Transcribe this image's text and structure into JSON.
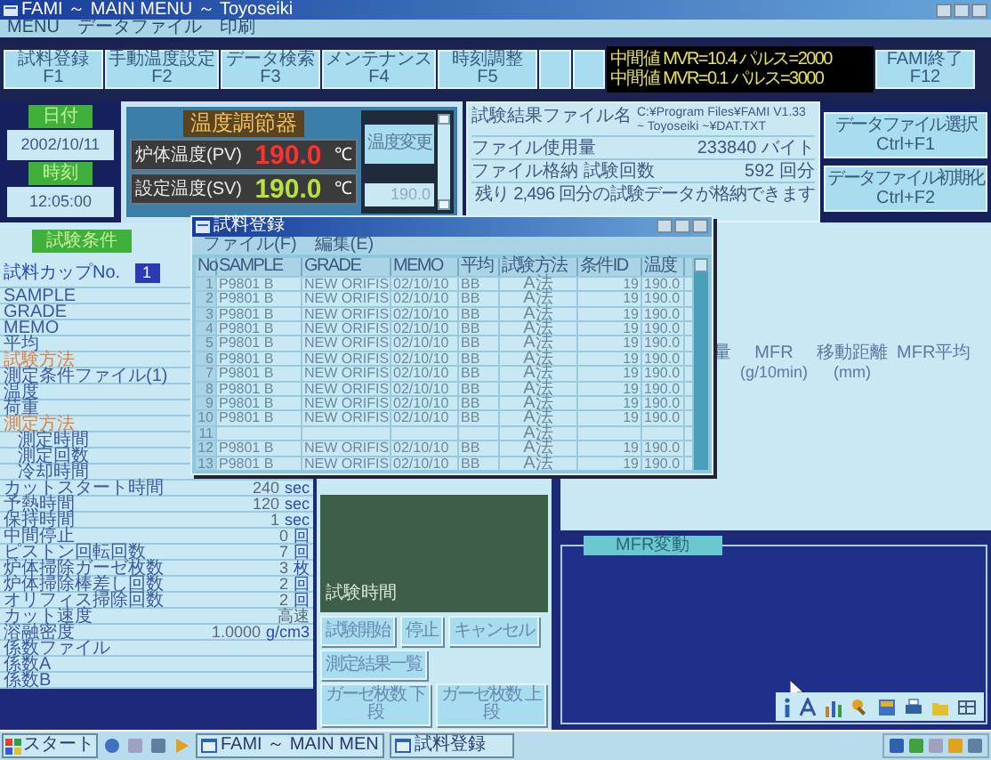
{
  "window": {
    "title": "FAMI ～ MAIN MENU ～ Toyoseiki"
  },
  "menu": [
    "MENU",
    "データファイル",
    "印刷"
  ],
  "function_buttons": [
    "試料登録 F1",
    "手動温度設定 F2",
    "データ検索 F3",
    "メンテナンス F4",
    "時刻調整 F5"
  ],
  "status_lines": [
    "中間値 MVR=10.4 パルス=2000",
    "中間値 MVR=0.1 パルス=3000"
  ],
  "exit_button": "FAMI終了 F12",
  "date": {
    "label": "日付",
    "value": "2002/10/11"
  },
  "time": {
    "label": "時刻",
    "value": "12:05:00"
  },
  "temperature": {
    "title": "温度調節器",
    "readings": [
      {
        "kind": "pv",
        "label": "炉体温度(PV)",
        "value": "190.0",
        "unit": "℃"
      },
      {
        "kind": "sv",
        "label": "設定温度(SV)",
        "value": "190.0",
        "unit": "℃"
      }
    ],
    "change_button": "温度変更",
    "input": "190.0"
  },
  "file_info": {
    "rows": [
      {
        "label": "試験結果ファイル名",
        "value": "C:¥Program Files¥FAMI V1.33 ~ Toyoseiki ~¥DAT.TXT"
      },
      {
        "label": "ファイル使用量",
        "value": "233840 バイト"
      },
      {
        "label": "ファイル格納 試験回数",
        "value": "592 回分"
      }
    ],
    "note": "残り 2,496 回分の試験データが格納できます",
    "buttons": [
      {
        "label": "データファイル選択",
        "key": "Ctrl+F1"
      },
      {
        "label": "データファイル初期化",
        "key": "Ctrl+F2"
      }
    ]
  },
  "conditions": {
    "title": "試験条件",
    "cup_label": "試料カップNo.",
    "cup_value": "1",
    "rows": [
      {
        "kind": "item",
        "label": "SAMPLE"
      },
      {
        "kind": "item",
        "label": "GRADE"
      },
      {
        "kind": "item",
        "label": "MEMO"
      },
      {
        "kind": "item",
        "label": "平均"
      },
      {
        "kind": "heading",
        "label": "試験方法"
      },
      {
        "kind": "item",
        "label": "測定条件ファイル(1)"
      },
      {
        "kind": "item",
        "label": "温度"
      },
      {
        "kind": "item",
        "label": "荷重"
      },
      {
        "kind": "heading",
        "label": "測定方法",
        "children": [
          {
            "kind": "item",
            "label": "測定時間"
          },
          {
            "kind": "item",
            "label": "測定回数"
          },
          {
            "kind": "item",
            "label": "冷却時間"
          }
        ]
      },
      {
        "kind": "item",
        "label": "カットスタート時間",
        "value": "240",
        "unit": "sec"
      },
      {
        "kind": "item",
        "label": "予熱時間",
        "value": "120",
        "unit": "sec"
      },
      {
        "kind": "item",
        "label": "保持時間",
        "value": "1",
        "unit": "sec"
      },
      {
        "kind": "item",
        "label": "中間停止",
        "value": "0",
        "unit": "回"
      },
      {
        "kind": "item",
        "label": "ピストン回転回数",
        "value": "7",
        "unit": "回"
      },
      {
        "kind": "item",
        "label": "炉体掃除ガーゼ枚数",
        "value": "3",
        "unit": "枚"
      },
      {
        "kind": "item",
        "label": "炉体掃除棒差し回数",
        "value": "2",
        "unit": "回"
      },
      {
        "kind": "item",
        "label": "オリフィス掃除回数",
        "value": "2",
        "unit": "回"
      },
      {
        "kind": "item",
        "label": "カット速度",
        "value": "高速"
      },
      {
        "kind": "item",
        "label": "溶融密度",
        "value": "1.0000",
        "unit": "g/cm3"
      },
      {
        "kind": "item",
        "label": "係数ファイル"
      },
      {
        "kind": "item",
        "label": "係数A"
      },
      {
        "kind": "item",
        "label": "係数B"
      }
    ]
  },
  "test_panel": {
    "timer_label": "試験時間",
    "buttons": [
      [
        "試験開始",
        "停止",
        "キャンセル"
      ],
      [
        "測定結果一覧"
      ],
      [
        "ガーゼ枚数 下段",
        "ガーゼ枚数 上段"
      ]
    ]
  },
  "results": {
    "columns": [
      {
        "label": "量"
      },
      {
        "label": "MFR",
        "unit": "(g/10min)"
      },
      {
        "label": "移動距離",
        "unit": "(mm)"
      },
      {
        "label": "MFR平均"
      }
    ],
    "graph_tab": "MFR変動"
  },
  "dialog": {
    "title": "試料登録",
    "menu": [
      "ファイル(F)",
      "編集(E)"
    ],
    "columns": [
      "No",
      "SAMPLE",
      "GRADE",
      "MEMO",
      "平均",
      "試験方法",
      "条件ID",
      "温度"
    ],
    "rows": [
      [
        "1",
        "P9801 B",
        "NEW ORIFIS",
        "02/10/10",
        "BB",
        "A法",
        "19",
        "190.0"
      ],
      [
        "2",
        "P9801 B",
        "NEW ORIFIS",
        "02/10/10",
        "BB",
        "A法",
        "19",
        "190.0"
      ],
      [
        "3",
        "P9801 B",
        "NEW ORIFIS",
        "02/10/10",
        "BB",
        "A法",
        "19",
        "190.0"
      ],
      [
        "4",
        "P9801 B",
        "NEW ORIFIS",
        "02/10/10",
        "BB",
        "A法",
        "19",
        "190.0"
      ],
      [
        "5",
        "P9801 B",
        "NEW ORIFIS",
        "02/10/10",
        "BB",
        "A法",
        "19",
        "190.0"
      ],
      [
        "6",
        "P9801 B",
        "NEW ORIFIS",
        "02/10/10",
        "BB",
        "A法",
        "19",
        "190.0"
      ],
      [
        "7",
        "P9801 B",
        "NEW ORIFIS",
        "02/10/10",
        "BB",
        "A法",
        "19",
        "190.0"
      ],
      [
        "8",
        "P9801 B",
        "NEW ORIFIS",
        "02/10/10",
        "BB",
        "A法",
        "19",
        "190.0"
      ],
      [
        "9",
        "P9801 B",
        "NEW ORIFIS",
        "02/10/10",
        "BB",
        "A法",
        "19",
        "190.0"
      ],
      [
        "10",
        "P9801 B",
        "NEW ORIFIS",
        "02/10/10",
        "BB",
        "A法",
        "19",
        "190.0"
      ],
      [
        "11",
        "",
        "",
        "",
        "",
        "A法",
        "",
        ""
      ],
      [
        "12",
        "P9801 B",
        "NEW ORIFIS",
        "02/10/10",
        "BB",
        "A法",
        "19",
        "190.0"
      ],
      [
        "13",
        "P9801 B",
        "NEW ORIFIS",
        "02/10/10",
        "BB",
        "A法",
        "19",
        "190.0"
      ]
    ]
  },
  "taskbar": {
    "start": "スタート",
    "tasks": [
      "FAMI ～ MAIN MEN",
      "試料登録"
    ]
  }
}
